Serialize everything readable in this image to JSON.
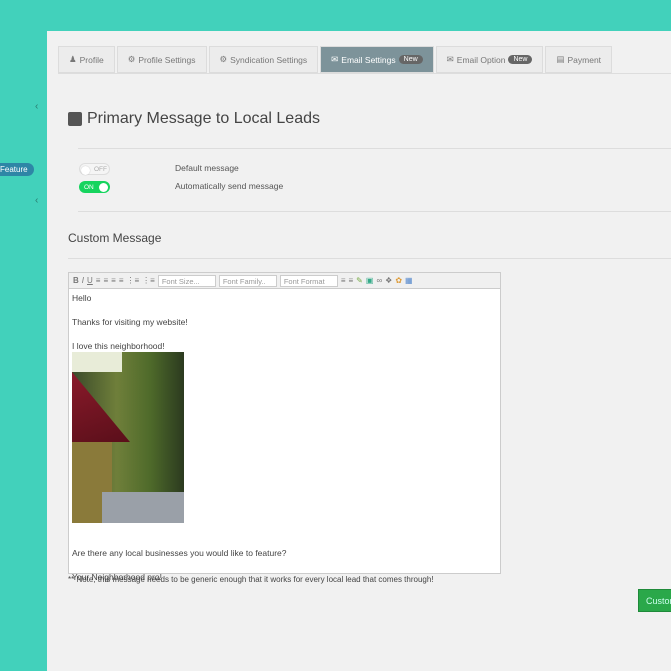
{
  "sidebar": {
    "feature_badge": "Feature",
    "chevron": "‹"
  },
  "tabs": [
    {
      "label": "Profile",
      "icon": "user-icon"
    },
    {
      "label": "Profile Settings",
      "icon": "gear-icon"
    },
    {
      "label": "Syndication Settings",
      "icon": "gear-icon"
    },
    {
      "label": "Email Settings",
      "icon": "envelope-icon",
      "badge": "New",
      "active": true
    },
    {
      "label": "Email Option",
      "icon": "envelope-icon",
      "badge": "New"
    },
    {
      "label": "Payment",
      "icon": "credit-card-icon"
    }
  ],
  "page_title": "Primary Message to Local Leads",
  "toggles": [
    {
      "state": "OFF",
      "label": "Default message"
    },
    {
      "state": "ON",
      "label": "Automatically send message"
    }
  ],
  "custom_message_heading": "Custom Message",
  "editor": {
    "toolbar": {
      "bold": "B",
      "italic": "I",
      "underline": "U",
      "font_size": "Font Size...",
      "font_family": "Font Family..",
      "font_format": "Font Format"
    },
    "lines": [
      "Hello",
      "Thanks for visiting my website!",
      "I love this neighborhood!",
      "Are there any local businesses you would like to feature?",
      "Your Neighborhood pro!"
    ]
  },
  "note": "** Note, this message needs to be generic enough that it works for every local lead that comes through!",
  "submit_button": "Custom"
}
